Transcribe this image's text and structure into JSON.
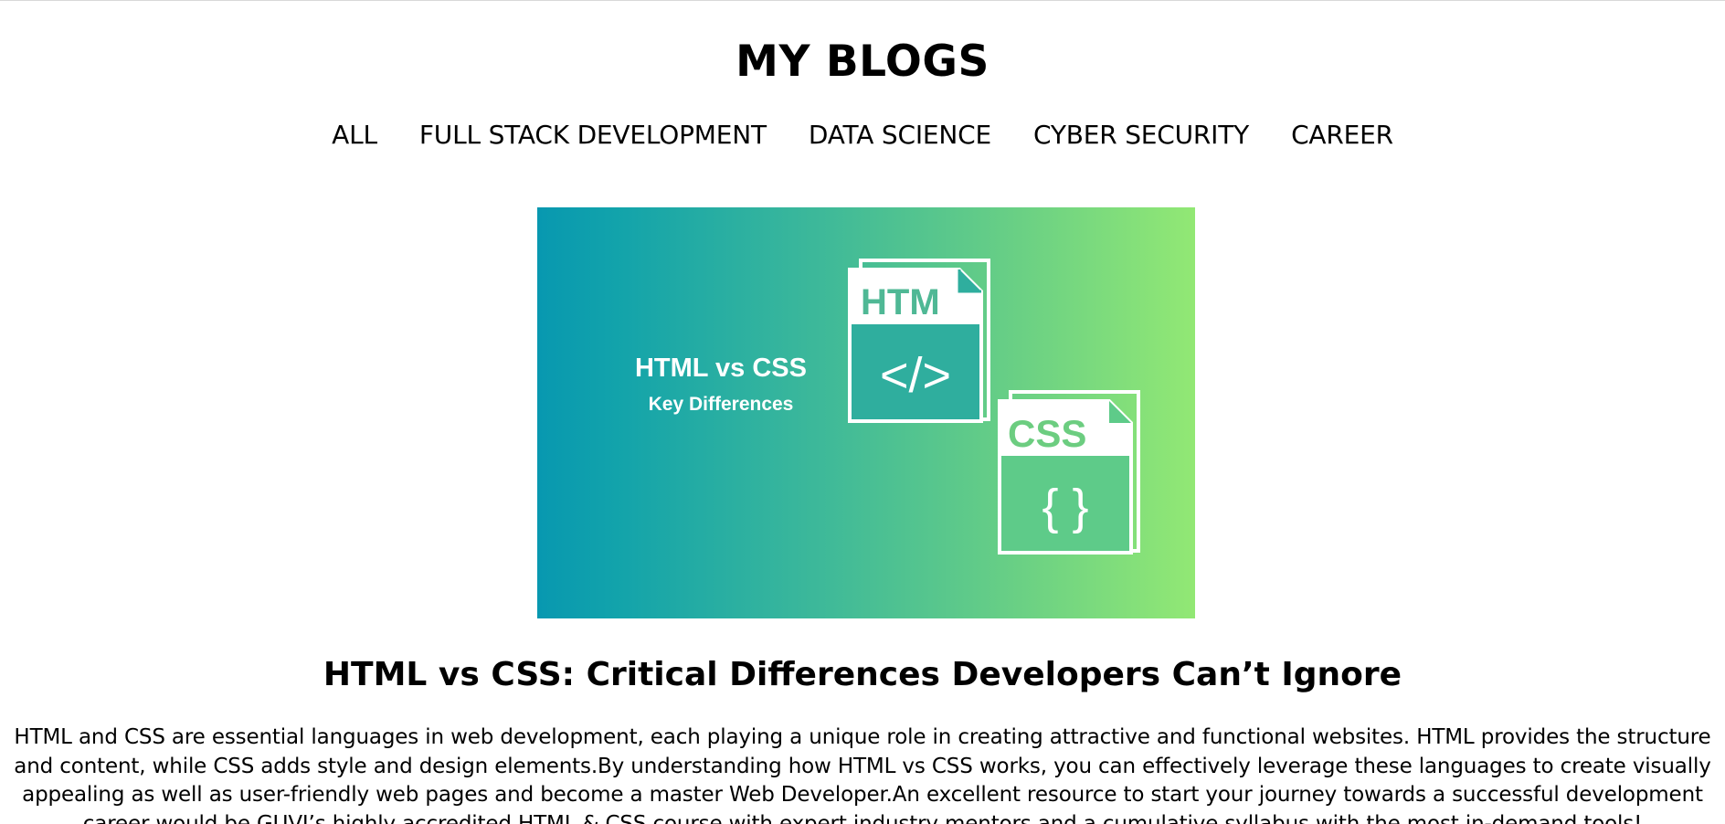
{
  "header": {
    "title": "MY BLOGS"
  },
  "nav": {
    "items": [
      {
        "label": "ALL"
      },
      {
        "label": "FULL STACK DEVELOPMENT"
      },
      {
        "label": "DATA SCIENCE"
      },
      {
        "label": "CYBER SECURITY"
      },
      {
        "label": "CAREER"
      }
    ]
  },
  "post": {
    "image": {
      "heading": "HTML vs CSS",
      "subheading": "Key Differences",
      "html_file_label": "HTM",
      "html_file_symbol": "</>",
      "css_file_label": "CSS",
      "css_file_symbol": "{ }",
      "colors": {
        "gradient_start": "#0898b0",
        "gradient_end": "#92e874",
        "file_stroke": "#ffffff",
        "file_label": "#4fbf8c"
      }
    },
    "title": "HTML vs CSS: Critical Differences Developers Can’t Ignore",
    "excerpt": "HTML and CSS are essential languages in web development, each playing a unique role in creating attractive and functional websites. HTML provides the structure and content, while CSS adds style and design elements.By understanding how HTML vs CSS works, you can effectively leverage these languages to create visually appealing as well as user-friendly web pages and become a master Web Developer.An excellent resource to start your journey towards a successful development career would be GUVI’s highly accredited HTML & CSS course with expert industry mentors and a cumulative syllabus with the most in-demand tools!"
  }
}
